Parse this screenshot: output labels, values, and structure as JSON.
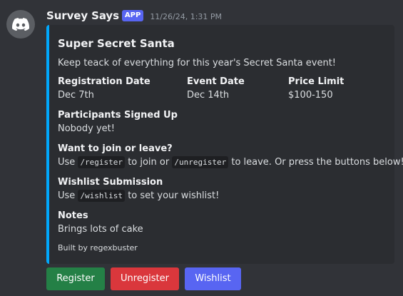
{
  "message": {
    "username": "Survey Says",
    "app_tag": "APP",
    "timestamp": "11/26/24, 1:31 PM",
    "avatar_icon": "discord-logo-icon"
  },
  "embed": {
    "accent_color": "#00a8fc",
    "title": "Super Secret Santa",
    "description": "Keep teack of everything for this year's Secret Santa event!",
    "fields": {
      "registration": {
        "name": "Registration Date",
        "value": "Dec 7th"
      },
      "event": {
        "name": "Event Date",
        "value": "Dec 14th"
      },
      "price": {
        "name": "Price Limit",
        "value": "$100-150"
      },
      "participants": {
        "name": "Participants Signed Up",
        "value": "Nobody yet!"
      },
      "join": {
        "name": "Want to join or leave?",
        "text_use": "Use",
        "cmd_register": "/register",
        "text_mid": "to join or",
        "cmd_unregister": "/unregister",
        "text_end": "to leave. Or press the buttons below!"
      },
      "wishlist": {
        "name": "Wishlist Submission",
        "text_use": "Use",
        "cmd_wishlist": "/wishlist",
        "text_end": "to set your wishlist!"
      },
      "notes": {
        "name": "Notes",
        "value": "Brings lots of cake"
      }
    },
    "footer": "Built by regexbuster"
  },
  "buttons": {
    "register": {
      "label": "Register",
      "color": "#248046"
    },
    "unregister": {
      "label": "Unregister",
      "color": "#da373c"
    },
    "wishlist": {
      "label": "Wishlist",
      "color": "#5865f2"
    }
  }
}
